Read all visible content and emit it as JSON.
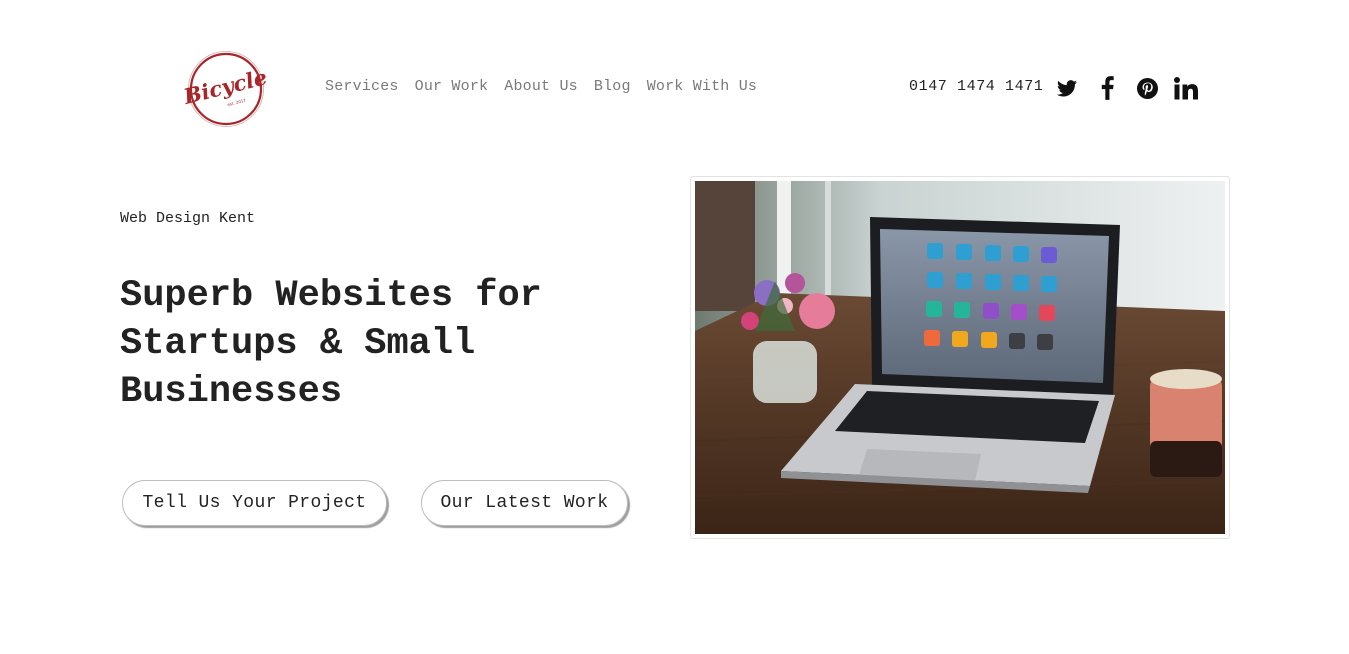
{
  "brand": {
    "logo_text": "Bicycle",
    "logo_subtext": "est. 2017",
    "accent_color": "#a8262a"
  },
  "nav": {
    "items": [
      {
        "label": "Services"
      },
      {
        "label": "Our Work"
      },
      {
        "label": "About Us"
      },
      {
        "label": "Blog"
      },
      {
        "label": "Work With Us"
      }
    ]
  },
  "contact": {
    "phone": "0147 1474 1471"
  },
  "social": {
    "icons": [
      "twitter-icon",
      "facebook-icon",
      "pinterest-icon",
      "linkedin-icon"
    ]
  },
  "hero": {
    "eyebrow": "Web Design Kent",
    "headline": "Superb Websites for Startups & Small Businesses",
    "primary_cta": "Tell Us Your Project",
    "secondary_cta": "Our Latest Work",
    "image_subject": "laptop-on-desk-image"
  }
}
